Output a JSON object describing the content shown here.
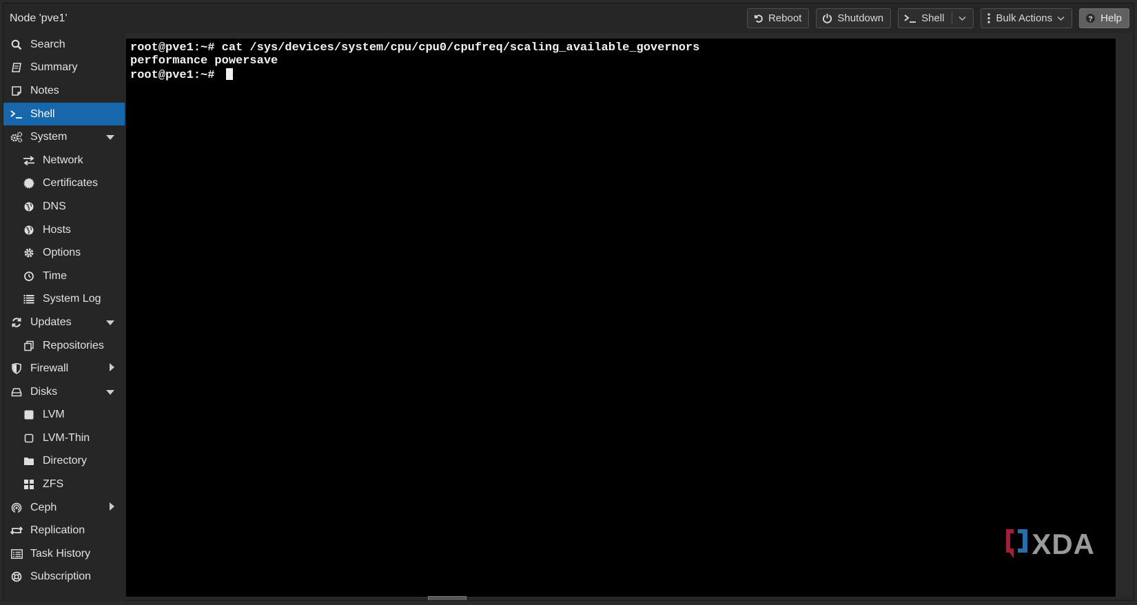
{
  "header": {
    "title": "Node 'pve1'",
    "buttons": {
      "reboot": "Reboot",
      "shutdown": "Shutdown",
      "shell": "Shell",
      "bulk_actions": "Bulk Actions",
      "help": "Help"
    }
  },
  "sidebar": {
    "items": [
      {
        "label": "Search",
        "icon": "search-icon"
      },
      {
        "label": "Summary",
        "icon": "book-icon"
      },
      {
        "label": "Notes",
        "icon": "notes-icon"
      },
      {
        "label": "Shell",
        "icon": "terminal-icon",
        "active": true
      },
      {
        "label": "System",
        "icon": "cogs-icon",
        "expanded": true
      },
      {
        "label": "Network",
        "icon": "exchange-icon"
      },
      {
        "label": "Certificates",
        "icon": "certificate-icon"
      },
      {
        "label": "DNS",
        "icon": "globe-icon"
      },
      {
        "label": "Hosts",
        "icon": "globe-icon"
      },
      {
        "label": "Options",
        "icon": "gear-icon"
      },
      {
        "label": "Time",
        "icon": "clock-icon"
      },
      {
        "label": "System Log",
        "icon": "list-icon"
      },
      {
        "label": "Updates",
        "icon": "refresh-icon",
        "expanded": true
      },
      {
        "label": "Repositories",
        "icon": "files-icon"
      },
      {
        "label": "Firewall",
        "icon": "shield-icon",
        "expanded": false
      },
      {
        "label": "Disks",
        "icon": "hdd-icon",
        "expanded": true
      },
      {
        "label": "LVM",
        "icon": "square-icon"
      },
      {
        "label": "LVM-Thin",
        "icon": "square-outline-icon"
      },
      {
        "label": "Directory",
        "icon": "folder-icon"
      },
      {
        "label": "ZFS",
        "icon": "th-large-icon"
      },
      {
        "label": "Ceph",
        "icon": "ceph-icon",
        "expanded": false
      },
      {
        "label": "Replication",
        "icon": "retweet-icon"
      },
      {
        "label": "Task History",
        "icon": "list-alt-icon"
      },
      {
        "label": "Subscription",
        "icon": "support-icon"
      }
    ]
  },
  "terminal": {
    "lines": [
      "root@pve1:~# cat /sys/devices/system/cpu/cpu0/cpufreq/scaling_available_governors",
      "performance powersave",
      "root@pve1:~# "
    ]
  },
  "watermark": {
    "text": "XDA"
  },
  "colors": {
    "accent": "#1667ac",
    "terminal_bg": "#000000",
    "panel_bg": "#262626"
  }
}
